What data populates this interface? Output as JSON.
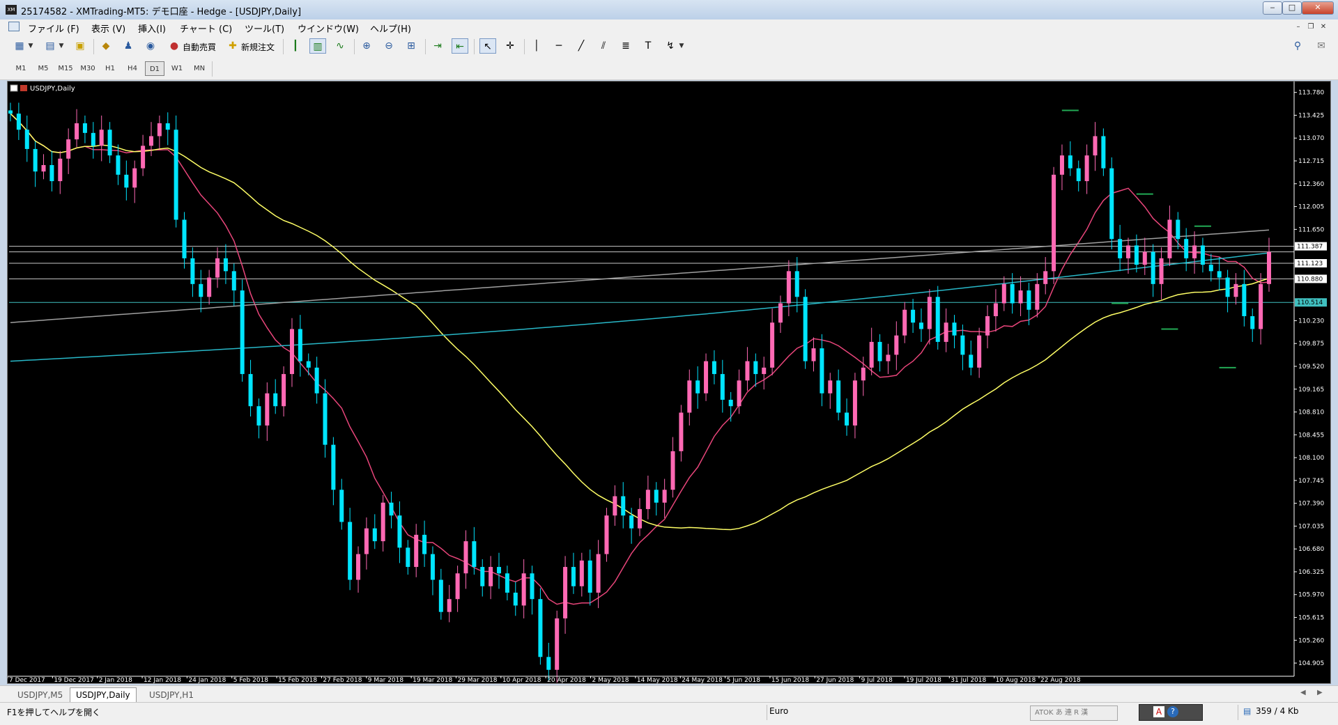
{
  "window": {
    "title": "25174582 - XMTrading-MT5: デモ口座 - Hedge - [USDJPY,Daily]",
    "app_icon": "XM"
  },
  "menu": [
    {
      "label": "ファイル (F)"
    },
    {
      "label": "表示 (V)"
    },
    {
      "label": "挿入(I)"
    },
    {
      "label": "チャート (C)"
    },
    {
      "label": "ツール(T)"
    },
    {
      "label": "ウインドウ(W)"
    },
    {
      "label": "ヘルプ(H)"
    }
  ],
  "toolbar": {
    "auto_trading_label": "自動売買",
    "new_order_label": "新規注文"
  },
  "timeframes": [
    "M1",
    "M5",
    "M15",
    "M30",
    "H1",
    "H4",
    "D1",
    "W1",
    "MN"
  ],
  "active_timeframe": "D1",
  "chart": {
    "symbol_label": "USDJPY,Daily",
    "background": "#000000",
    "colors": {
      "bull": "#ff69b4",
      "bear": "#00e5ff",
      "ma_fast": "#e8457a",
      "ma_mid": "#28b8c8",
      "ma_slow": "#ffff66",
      "ma_long": "#a0a0a0",
      "marker": "#22aa55",
      "level": "#c8c8c8",
      "current": "#40c0c0"
    },
    "price_axis": [
      "113.780",
      "113.425",
      "113.070",
      "112.715",
      "112.360",
      "112.005",
      "111.650",
      "110.230",
      "109.875",
      "109.520",
      "109.165",
      "108.810",
      "108.455",
      "108.100",
      "107.745",
      "107.390",
      "107.035",
      "106.680",
      "106.325",
      "105.970",
      "105.615",
      "105.260",
      "104.905"
    ],
    "price_tags": [
      {
        "price": 111.387,
        "label": "111.387",
        "bg": "#ffffff",
        "fg": "#000000"
      },
      {
        "price": 111.123,
        "label": "111.123",
        "bg": "#ffffff",
        "fg": "#000000"
      },
      {
        "price": 110.88,
        "label": "110.880",
        "bg": "#ffffff",
        "fg": "#000000"
      },
      {
        "price": 110.514,
        "label": "110.514",
        "bg": "#40c0c0",
        "fg": "#000000"
      }
    ],
    "date_axis": [
      "7 Dec 2017",
      "19 Dec 2017",
      "2 Jan 2018",
      "12 Jan 2018",
      "24 Jan 2018",
      "5 Feb 2018",
      "15 Feb 2018",
      "27 Feb 2018",
      "9 Mar 2018",
      "19 Mar 2018",
      "29 Mar 2018",
      "10 Apr 2018",
      "20 Apr 2018",
      "2 May 2018",
      "14 May 2018",
      "24 May 2018",
      "5 Jun 2018",
      "15 Jun 2018",
      "27 Jun 2018",
      "9 Jul 2018",
      "19 Jul 2018",
      "31 Jul 2018",
      "10 Aug 2018",
      "22 Aug 2018"
    ],
    "horizontal_levels": [
      111.387,
      111.3,
      111.123,
      110.88
    ],
    "current_price": 110.514
  },
  "chart_data": {
    "type": "candlestick",
    "symbol": "USDJPY",
    "timeframe": "Daily",
    "ylim": [
      104.7,
      113.95
    ],
    "close_series": [
      113.45,
      113.2,
      112.9,
      112.55,
      112.65,
      112.4,
      112.75,
      113.05,
      113.3,
      113.15,
      112.95,
      113.2,
      112.8,
      112.5,
      112.3,
      112.6,
      112.95,
      113.1,
      113.3,
      113.2,
      111.8,
      111.2,
      110.8,
      110.6,
      110.9,
      111.2,
      111.0,
      110.7,
      109.4,
      108.9,
      108.6,
      109.1,
      108.9,
      109.4,
      110.1,
      109.6,
      109.5,
      109.1,
      108.3,
      107.6,
      107.1,
      106.2,
      106.6,
      107.0,
      106.8,
      107.4,
      107.2,
      106.7,
      106.4,
      106.9,
      106.6,
      106.2,
      105.7,
      105.9,
      106.3,
      106.8,
      106.4,
      106.1,
      106.4,
      106.3,
      106.0,
      105.8,
      106.3,
      105.9,
      105.0,
      104.8,
      105.6,
      106.4,
      106.1,
      106.5,
      106.0,
      106.6,
      107.2,
      107.5,
      107.2,
      107.0,
      107.3,
      107.6,
      107.4,
      107.6,
      108.2,
      108.8,
      109.3,
      109.1,
      109.6,
      109.4,
      109.0,
      108.9,
      109.3,
      109.6,
      109.4,
      109.5,
      110.2,
      110.5,
      111.0,
      110.6,
      109.6,
      109.8,
      109.1,
      109.3,
      108.8,
      108.6,
      109.3,
      109.5,
      109.9,
      109.6,
      109.7,
      110.0,
      110.4,
      110.2,
      110.1,
      110.6,
      109.9,
      110.2,
      110.0,
      109.7,
      109.5,
      110.0,
      110.3,
      110.5,
      110.8,
      110.5,
      110.7,
      110.4,
      110.8,
      111.0,
      112.5,
      112.8,
      112.6,
      112.4,
      112.8,
      113.1,
      112.6,
      111.5,
      111.2,
      111.4,
      111.1,
      111.3,
      110.8,
      111.2,
      111.8,
      111.5,
      111.2,
      111.4,
      111.1,
      111.0,
      110.9,
      110.6,
      110.8,
      110.3,
      110.1,
      110.8,
      111.3
    ]
  },
  "chart_tabs": [
    {
      "label": "USDJPY,M5"
    },
    {
      "label": "USDJPY,Daily"
    },
    {
      "label": "USDJPY,H1"
    }
  ],
  "active_chart_tab": 1,
  "status": {
    "help_text": "F1を押してヘルプを開く",
    "profile": "Euro",
    "ime_text": "ATOK あ 連 R 漢",
    "traffic": "359 / 4 Kb"
  }
}
